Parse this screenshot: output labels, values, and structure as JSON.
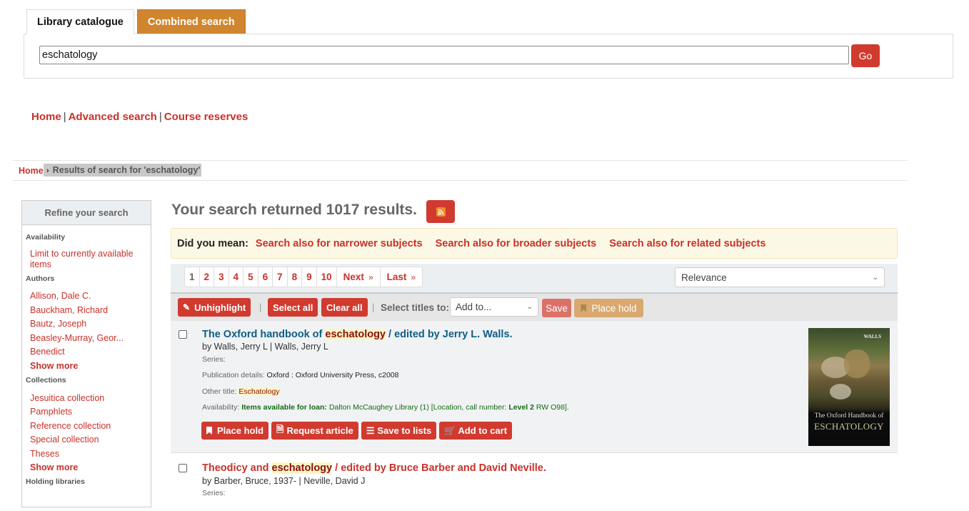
{
  "tabs": [
    {
      "label": "Library catalogue",
      "active": true
    },
    {
      "label": "Combined search",
      "active": false
    }
  ],
  "search": {
    "value": "eschatology",
    "go_label": "Go"
  },
  "nav_links": [
    "Home",
    "Advanced search",
    "Course reserves"
  ],
  "nav_separator": "|",
  "breadcrumb": {
    "home": "Home",
    "current": "Results of search for 'eschatology'"
  },
  "sidebar": {
    "title": "Refine your search",
    "facets": {
      "availability": {
        "title": "Availability",
        "items": [
          "Limit to currently available items"
        ]
      },
      "authors": {
        "title": "Authors",
        "items": [
          "Allison, Dale C.",
          "Bauckham, Richard",
          "Bautz, Joseph",
          "Beasley-Murray, Geor...",
          "Benedict"
        ],
        "more": "Show more"
      },
      "collections": {
        "title": "Collections",
        "items": [
          "Jesuitica collection",
          "Pamphlets",
          "Reference collection",
          "Special collection",
          "Theses"
        ],
        "more": "Show more"
      },
      "holding": {
        "title": "Holding libraries"
      }
    }
  },
  "results_header": {
    "text": "Your search returned 1017 results.",
    "rss_icon": "rss-feed-icon"
  },
  "did_you_mean": {
    "label": "Did you mean:",
    "links": [
      "Search also for narrower subjects",
      "Search also for broader subjects",
      "Search also for related subjects"
    ]
  },
  "pagination": {
    "pages": [
      "1",
      "2",
      "3",
      "4",
      "5",
      "6",
      "7",
      "8",
      "9",
      "10"
    ],
    "current": "1",
    "next": "Next",
    "last": "Last"
  },
  "sort": {
    "selected": "Relevance"
  },
  "toolbar": {
    "unhighlight": "Unhighlight",
    "select_all": "Select all",
    "clear_all": "Clear all",
    "select_titles_label": "Select titles to:",
    "add_to": "Add to...",
    "save": "Save",
    "place_hold": "Place hold"
  },
  "results": [
    {
      "title_before": "The Oxford handbook of ",
      "title_highlight": "eschatology",
      "title_after": " / edited by Jerry L. Walls.",
      "authors": "by Walls, Jerry L |  Walls, Jerry L",
      "series_label": "Series:",
      "publication_label": "Publication details:",
      "publication_value": "Oxford : Oxford University Press, c2008",
      "other_title_label": "Other title:",
      "other_title_value": "Eschatology",
      "availability_label": "Availability:",
      "availability_status": "Items available for loan:",
      "availability_library": "Dalton McCaughey Library (1) [Location, call number:",
      "availability_level": "Level 2",
      "availability_call": "RW O98].",
      "actions": [
        "Place hold",
        "Request article",
        "Save to lists",
        "Add to cart"
      ],
      "cover": {
        "editor": "WALLS",
        "line1": "The Oxford Handbook of",
        "line2": "ESCHATOLOGY"
      }
    },
    {
      "title_before": "Theodicy and ",
      "title_highlight": "eschatology",
      "title_after": " / edited by Bruce Barber and David Neville.",
      "authors": "by Barber, Bruce, 1937-  |  Neville, David J",
      "series_label": "Series:"
    }
  ],
  "colors": {
    "accent_red": "#d13a2f",
    "link_red": "#c8322a",
    "combined_tab": "#d0862e",
    "title_blue": "#0f5e85",
    "available_green": "#156a15"
  }
}
